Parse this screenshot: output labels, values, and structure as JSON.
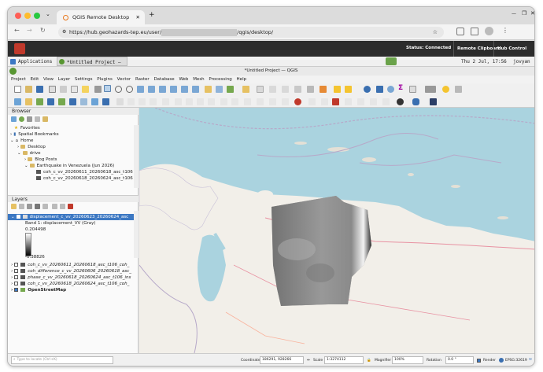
{
  "browser": {
    "tab_title": "QGIS Remote Desktop",
    "new_tab": "+",
    "url_start": "https://hub.geohazards-tep.eu/user/",
    "url_end": "/qgis/desktop/"
  },
  "vnc": {
    "status_label": "Status:",
    "status_value": "Connected",
    "clipboard": "Remote Clipboard",
    "hub": "Hub Control Panel"
  },
  "taskbar": {
    "applications": "Applications",
    "window": "*Untitled Project — ...",
    "clock": "Thu  2 Jul, 17:56",
    "user": "jovyan"
  },
  "qgis": {
    "title": "*Untitled Project — QGIS",
    "menu": [
      "Project",
      "Edit",
      "View",
      "Layer",
      "Settings",
      "Plugins",
      "Vector",
      "Raster",
      "Database",
      "Web",
      "Mesh",
      "Processing",
      "Help"
    ]
  },
  "browser_panel": {
    "title": "Browser",
    "items": [
      {
        "label": "Favorites",
        "kind": "star"
      },
      {
        "label": "Spatial Bookmarks",
        "kind": "bookmark"
      },
      {
        "label": "Home",
        "kind": "home"
      },
      {
        "label": "Desktop",
        "kind": "folder"
      },
      {
        "label": "drive",
        "kind": "folder"
      },
      {
        "label": "Blog Posts",
        "kind": "folder"
      },
      {
        "label": "Earthquake in Venezuela (Jun 2026)",
        "kind": "folder"
      },
      {
        "label": "coh_c_vv_20260611_20260618_asc_t106",
        "kind": "raster"
      },
      {
        "label": "coh_c_vv_20260618_20260624_asc_t106",
        "kind": "raster"
      }
    ]
  },
  "layers_panel": {
    "title": "Layers",
    "selected": "displacement_c_vv_20260623_20260624_asc",
    "band": "Band 1: displacement_VV (Gray)",
    "max": "0.204498",
    "min": "-0.38826",
    "others": [
      "coh_c_vv_20260611_20260618_asc_t106_coh_",
      "coh_difference_c_vv_20260606_20260618_asc_",
      "phase_c_vv_20260618_20260624_asc_t106_ins",
      "coh_c_vv_20260618_20260624_asc_t106_coh_"
    ],
    "basemap": "OpenStreetMap"
  },
  "status": {
    "locate": "Type to locate (Ctrl+K)",
    "coordinate_label": "Coordinate",
    "coordinate": "186291, 928266",
    "scale_label": "Scale",
    "scale": "1:3274112",
    "magnifier_label": "Magnifier",
    "magnifier": "100%",
    "rotation_label": "Rotation",
    "rotation": "0.0 °",
    "render": "Render",
    "crs": "EPSG:32619"
  },
  "colors": {
    "sea": "#aad3df",
    "land": "#f2efe9",
    "accent": "#589632",
    "vnc_bar": "#2c2c2c"
  }
}
